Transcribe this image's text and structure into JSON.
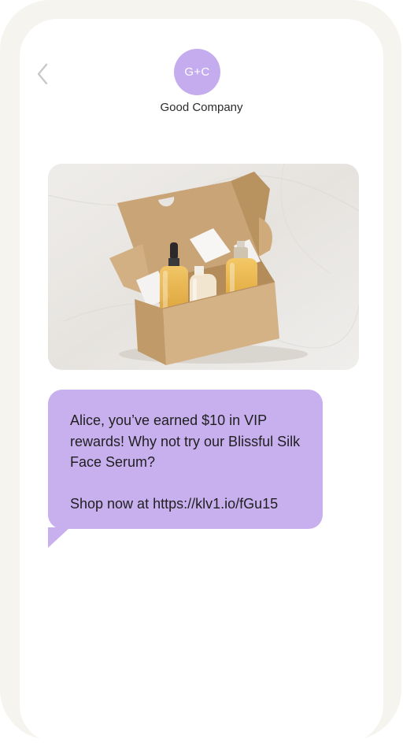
{
  "header": {
    "back_icon": "chevron-left-icon",
    "avatar_initials": "G+C",
    "contact_name": "Good Company"
  },
  "message": {
    "image_subject": "Open kraft gift box with face serum bottles",
    "body_line_1": "Alice, you’ve earned $10 in VIP rewards! Why not try our Blissful Silk Face Serum?",
    "body_line_2": "Shop now at https://klv1.io/fGu15"
  },
  "colors": {
    "avatar": "#c5acef",
    "bubble": "#c8b0ef",
    "frame": "#f6f4ef",
    "screen": "#ffffff"
  }
}
